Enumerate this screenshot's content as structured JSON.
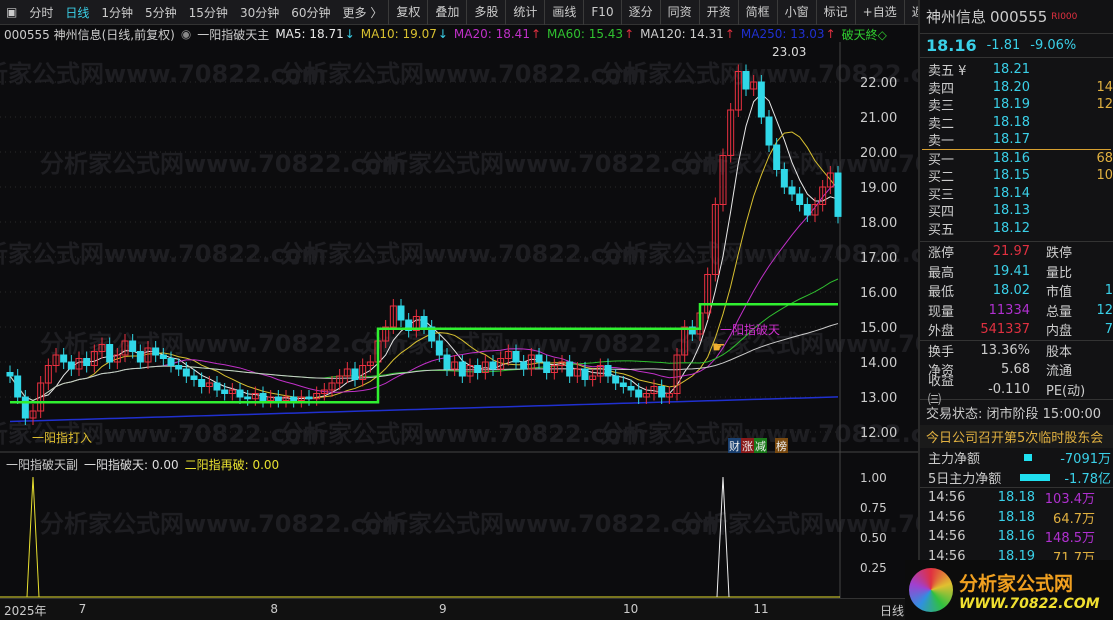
{
  "toolbar": {
    "periods": [
      "分时",
      "日线",
      "1分钟",
      "5分钟",
      "15分钟",
      "30分钟",
      "60分钟",
      "更多 〉"
    ],
    "active": "日线",
    "buttons": [
      "复权",
      "叠加",
      "多股",
      "统计",
      "画线",
      "F10",
      "逐分",
      "同资",
      "开资",
      "简框",
      "小窗",
      "标记",
      "+自选",
      "返回"
    ]
  },
  "legend": {
    "title": "000555 神州信息(日线,前复权)",
    "indicator": "一阳指破天主",
    "ma": [
      {
        "label": "MA5: 18.71",
        "color": "#e8e8e8",
        "arrow": "↓",
        "arrow_color": "#3ad0e8"
      },
      {
        "label": "MA10: 19.07",
        "color": "#d8c030",
        "arrow": "↓",
        "arrow_color": "#3ad0e8"
      },
      {
        "label": "MA20: 18.41",
        "color": "#c030c8",
        "arrow": "↑",
        "arrow_color": "#e03040"
      },
      {
        "label": "MA60: 15.43",
        "color": "#30c030",
        "arrow": "↑",
        "arrow_color": "#e03040"
      },
      {
        "label": "MA120: 14.31",
        "color": "#cccccc",
        "arrow": "↑",
        "arrow_color": "#e03040"
      },
      {
        "label": "MA250: 13.03",
        "color": "#2030d0",
        "arrow": "↑",
        "arrow_color": "#e03040"
      }
    ],
    "extra": "破天終◇"
  },
  "chart_data": {
    "type": "candlestick",
    "price_ticks": [
      "22.00",
      "21.00",
      "20.00",
      "19.00",
      "18.00",
      "17.00",
      "16.00",
      "15.00",
      "14.00",
      "13.00",
      "12.00"
    ],
    "ylim": [
      11.6,
      23.3
    ],
    "closes": [
      13.6,
      13.0,
      12.4,
      12.6,
      13.4,
      13.9,
      14.2,
      14.0,
      13.8,
      14.1,
      13.9,
      14.3,
      14.5,
      14.0,
      14.2,
      14.6,
      14.3,
      14.0,
      14.4,
      14.2,
      14.1,
      13.9,
      13.8,
      13.6,
      13.5,
      13.3,
      13.4,
      13.2,
      13.1,
      13.2,
      13.0,
      12.95,
      13.1,
      12.9,
      13.0,
      12.9,
      13.0,
      12.9,
      13.0,
      12.95,
      13.1,
      13.2,
      13.4,
      13.6,
      13.8,
      13.5,
      13.9,
      14.0,
      14.6,
      15.0,
      15.6,
      15.2,
      14.9,
      15.3,
      15.0,
      14.6,
      14.2,
      13.8,
      14.0,
      13.6,
      13.9,
      13.7,
      14.0,
      13.8,
      14.1,
      14.3,
      14.0,
      13.8,
      14.2,
      14.0,
      13.7,
      13.9,
      14.0,
      13.6,
      13.8,
      13.5,
      13.6,
      13.9,
      13.6,
      13.4,
      13.3,
      13.2,
      13.0,
      13.1,
      13.3,
      13.0,
      13.1,
      14.2,
      15.0,
      14.8,
      15.4,
      16.5,
      18.5,
      19.9,
      21.2,
      22.3,
      21.8,
      22.0,
      21.0,
      20.2,
      19.5,
      19.0,
      18.8,
      18.5,
      18.2,
      18.5,
      19.0,
      19.4,
      18.16
    ],
    "breakout_levels": [
      {
        "from": 0,
        "to": 48,
        "value": 12.85
      },
      {
        "from": 48,
        "to": 90,
        "value": 14.95
      },
      {
        "from": 90,
        "to": 108,
        "value": 15.65
      }
    ],
    "annotations": {
      "high": "23.03",
      "signal1": "一阳指打入",
      "signal2": "一阳指破天"
    },
    "badges": [
      "财",
      "涨",
      "减",
      "榜"
    ],
    "sub": {
      "ticks": [
        "1.00",
        "0.75",
        "0.50",
        "0.25"
      ],
      "yellow_signals": [
        3
      ],
      "white_signals": [
        93
      ]
    },
    "x_labels": [
      {
        "label": "2025年",
        "index": 0
      },
      {
        "label": "7",
        "index": 10
      },
      {
        "label": "8",
        "index": 35
      },
      {
        "label": "9",
        "index": 57
      },
      {
        "label": "10",
        "index": 81
      },
      {
        "label": "11",
        "index": 98
      }
    ],
    "period_label": "日线"
  },
  "sublegend": {
    "name": "一阳指破天副",
    "v1": "一阳指破天: 0.00",
    "v2": "二阳指再破: 0.00"
  },
  "watermark": "分析家公式网www.70822.com",
  "quote": {
    "name": "神州信息",
    "code": "000555",
    "tag": "RI000",
    "price": "18.16",
    "change": "-1.81",
    "pct": "-9.06%",
    "asks": [
      {
        "l": "卖五 ¥",
        "p": "18.21",
        "v": ""
      },
      {
        "l": "卖四",
        "p": "18.20",
        "v": "14"
      },
      {
        "l": "卖三",
        "p": "18.19",
        "v": "12"
      },
      {
        "l": "卖二",
        "p": "18.18",
        "v": ""
      },
      {
        "l": "卖一",
        "p": "18.17",
        "v": ""
      }
    ],
    "bids": [
      {
        "l": "买一",
        "p": "18.16",
        "v": "68"
      },
      {
        "l": "买二",
        "p": "18.15",
        "v": "10"
      },
      {
        "l": "买三",
        "p": "18.14",
        "v": ""
      },
      {
        "l": "买四",
        "p": "18.13",
        "v": ""
      },
      {
        "l": "买五",
        "p": "18.12",
        "v": ""
      }
    ],
    "stats": [
      {
        "l": "涨停",
        "v": "21.97",
        "c": "#e03040",
        "l2": "跌停",
        "v2": ""
      },
      {
        "l": "最高",
        "v": "19.41",
        "c": "#3ad0e8",
        "l2": "量比",
        "v2": ""
      },
      {
        "l": "最低",
        "v": "18.02",
        "c": "#3ad0e8",
        "l2": "市值",
        "v2": "1"
      },
      {
        "l": "现量",
        "v": "11334",
        "c": "#b030d0",
        "l2": "总量",
        "v2": "12"
      },
      {
        "l": "外盘",
        "v": "541337",
        "c": "#e03040",
        "l2": "内盘",
        "v2": "7"
      }
    ],
    "stats2": [
      {
        "l": "换手",
        "v": "13.36%",
        "l2": "股本"
      },
      {
        "l": "净资",
        "v": "5.68",
        "l2": "流通"
      },
      {
        "l": "收益㈢",
        "v": "-0.110",
        "l2": "PE(动)"
      }
    ],
    "status": "交易状态: 闭市阶段 15:00:00",
    "notice": "今日公司召开第5次临时股东会",
    "flow": [
      {
        "l": "主力净额",
        "v": "-7091万"
      },
      {
        "l": "5日主力净额",
        "v": "-1.78亿"
      }
    ],
    "ticks": [
      {
        "t": "14:56",
        "p": "18.18",
        "v": "103.4万",
        "c": "#b030d0"
      },
      {
        "t": "14:56",
        "p": "18.18",
        "v": "64.7万",
        "c": "#e0b040"
      },
      {
        "t": "14:56",
        "p": "18.16",
        "v": "148.5万",
        "c": "#b030d0"
      },
      {
        "t": "14:56",
        "p": "18.19",
        "v": "71.7万",
        "c": "#e0b040"
      }
    ]
  },
  "logo": {
    "cn": "分析家公式网",
    "url": "WWW.70822.COM"
  }
}
